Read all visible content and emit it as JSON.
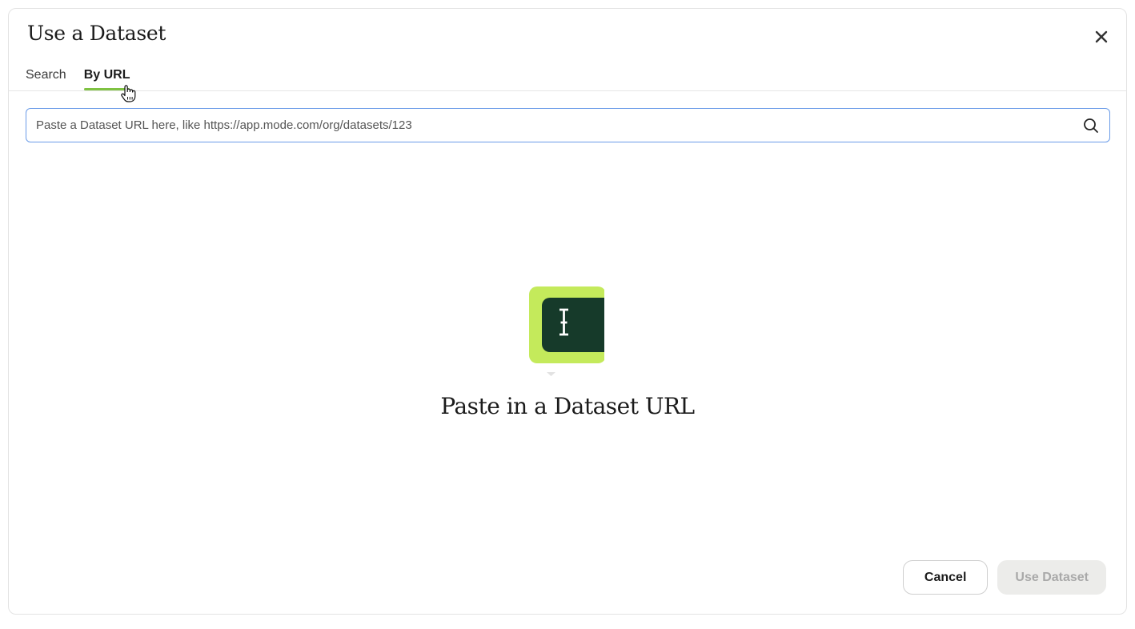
{
  "dialog": {
    "title": "Use a Dataset",
    "close_icon": "close-icon"
  },
  "tabs": [
    {
      "label": "Search",
      "active": false
    },
    {
      "label": "By URL",
      "active": true
    }
  ],
  "url_input": {
    "placeholder": "Paste a Dataset URL here, like https://app.mode.com/org/datasets/123",
    "value": "",
    "icon": "search-icon"
  },
  "empty_state": {
    "icon": "text-cursor-icon",
    "title": "Paste in a Dataset URL"
  },
  "footer": {
    "cancel_label": "Cancel",
    "confirm_label": "Use Dataset"
  },
  "colors": {
    "accent_green": "#7fc242",
    "illustration_lime": "#c4ea5b",
    "illustration_dark": "#163a2a",
    "input_border": "#6a9be8",
    "disabled_button_bg": "#ececea"
  }
}
